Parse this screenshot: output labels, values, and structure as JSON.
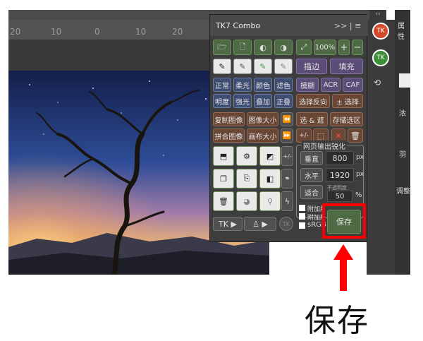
{
  "ruler": {
    "marks": [
      "20",
      "10",
      "0",
      "10",
      "20"
    ]
  },
  "right_panel": {
    "label_top": "属性",
    "label_a": "浓",
    "label_b": "羽",
    "label_c": "调整"
  },
  "panel": {
    "title": "TK7 Combo",
    "menu_glyph": ">> | ≡",
    "zoom_percent": "100%",
    "blend_row1": [
      "正常",
      "柔光",
      "颜色",
      "滤色"
    ],
    "blend_row2": [
      "明度",
      "强光",
      "叠加",
      "正叠"
    ],
    "right_btns": [
      "描边",
      "填充",
      "模糊",
      "ACR",
      "CAF",
      "选择反向",
      "± 选择",
      "选 & 遮",
      "存储选区",
      "+/-"
    ],
    "image_btns": [
      "复制图像",
      "图像大小",
      "拼合图像",
      "画布大小"
    ],
    "side_small": [
      "+/-",
      "+/-"
    ],
    "sharpen_title": "网页输出锐化",
    "vertical_label": "垂直",
    "vertical_value": "800",
    "horizontal_label": "水平",
    "horizontal_value": "1920",
    "unit_px": "px",
    "fit_label": "适合",
    "opacity_label": "不透明度",
    "opacity_value": "50",
    "unit_pct": "%",
    "checks": [
      "附加版",
      "附加版本",
      "sRGB"
    ],
    "save_label": "保存",
    "tk_btn": "TK ▶",
    "user_btn": "♙ ▶"
  },
  "annotation": {
    "label": "保存",
    "color": "#ff0000"
  }
}
